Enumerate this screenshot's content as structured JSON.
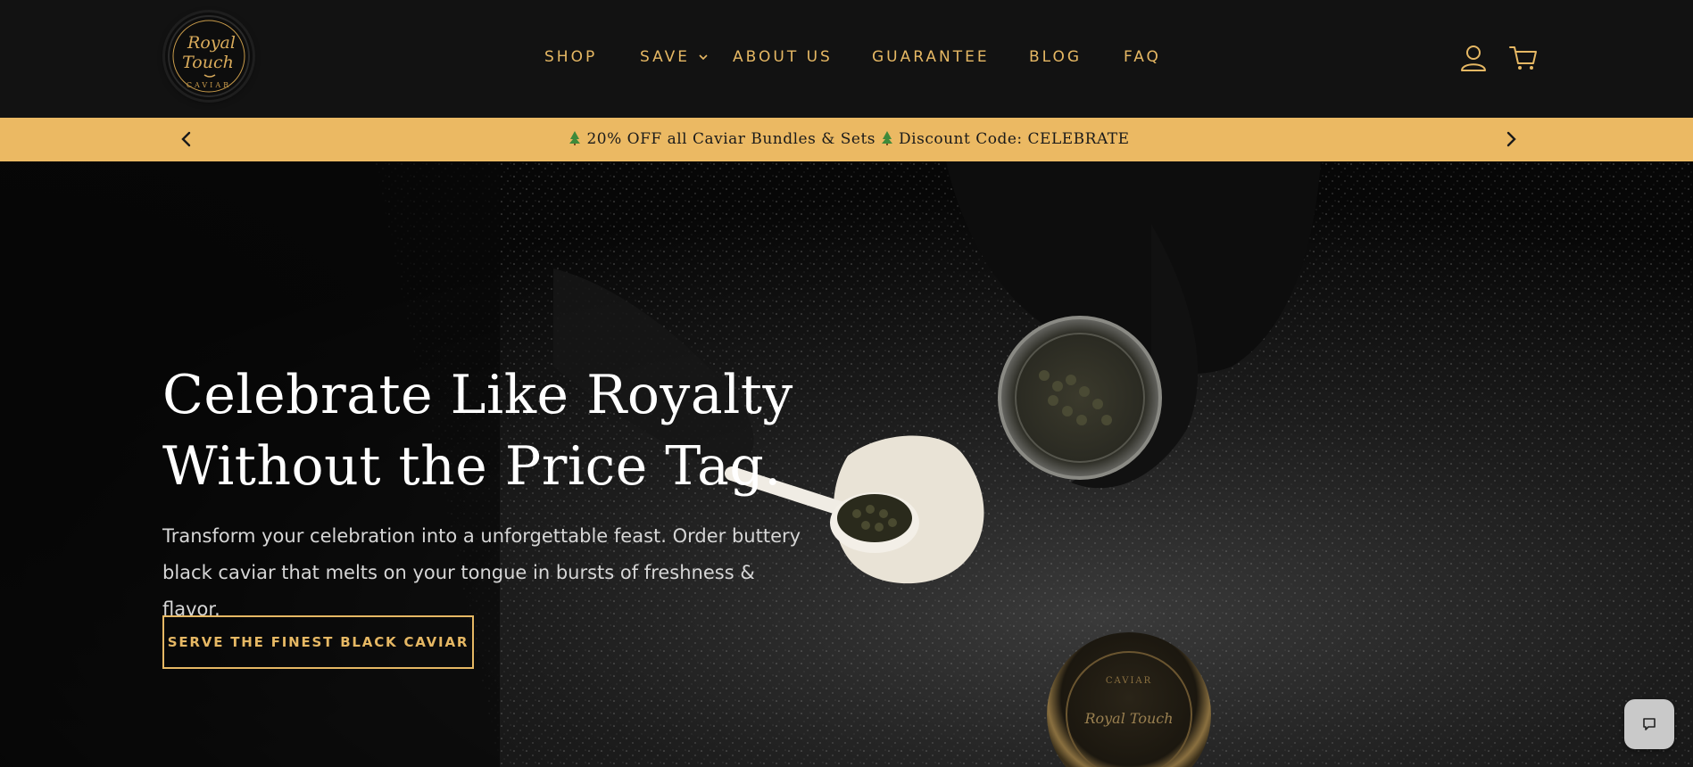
{
  "header": {
    "logo": {
      "line1": "Royal",
      "line2": "Touch",
      "line3": "CAVIAR",
      "icon": "royal-touch-logo"
    },
    "nav": [
      {
        "label": "SHOP"
      },
      {
        "label": "SAVE",
        "has_dropdown": true
      },
      {
        "label": "ABOUT US"
      },
      {
        "label": "GUARANTEE"
      },
      {
        "label": "BLOG"
      },
      {
        "label": "FAQ"
      }
    ],
    "icons": {
      "account": "account-icon",
      "cart": "cart-icon"
    }
  },
  "promo": {
    "text_part1": "20% OFF all Caviar Bundles & Sets",
    "text_part2": "Discount Code: CELEBRATE",
    "icon": "christmas-tree-icon",
    "prev_icon": "chevron-left-icon",
    "next_icon": "chevron-right-icon"
  },
  "hero": {
    "title_line1": "Celebrate Like Royalty",
    "title_line2": "Without the Price Tag.",
    "subtitle_line1": "Transform your celebration into a unforgettable feast. Order buttery",
    "subtitle_line2": "black caviar that melts on your tongue in bursts of freshness & flavor.",
    "cta_label": "SERVE THE FINEST BLACK CAVIAR",
    "tin_label_top": "CAVIAR",
    "tin_label_script": "Royal Touch"
  },
  "chat": {
    "icon": "chat-bubble-icon"
  },
  "colors": {
    "header_bg": "#121212",
    "accent_gold": "#e6b864",
    "promo_bg": "#ebb963",
    "hero_bg": "#0a0a0a"
  }
}
